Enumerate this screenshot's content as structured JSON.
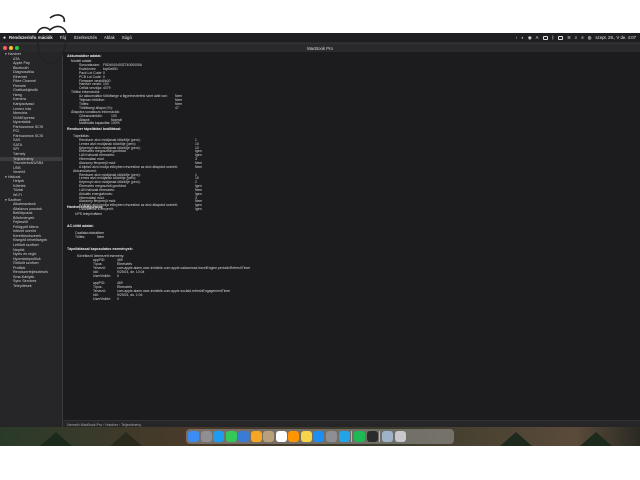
{
  "menubar": {
    "app_name": "Rendszerinformációk",
    "menu_items": [
      "Fájl",
      "Szerkesztés",
      "Ablak",
      "Súgó"
    ],
    "clock": "szept. 29., V de. 4:07"
  },
  "window": {
    "title": "MacBook Pro",
    "path_bar": "Nemeth MacBook Pro › Hardver › Teljesítmény"
  },
  "sidebar": {
    "items": [
      {
        "label": "Hardver",
        "group": true
      },
      {
        "label": "ATA"
      },
      {
        "label": "Apple Pay"
      },
      {
        "label": "Bluetooth"
      },
      {
        "label": "Diagnosztika"
      },
      {
        "label": "Ethernet"
      },
      {
        "label": "Fibre Channel"
      },
      {
        "label": "Firewire"
      },
      {
        "label": "Grafika/kijelzők"
      },
      {
        "label": "Hang"
      },
      {
        "label": "Kamera"
      },
      {
        "label": "Kártyaolvasó"
      },
      {
        "label": "Lemez írás"
      },
      {
        "label": "Memória"
      },
      {
        "label": "NVMExpress"
      },
      {
        "label": "Nyomtatók"
      },
      {
        "label": "Párhuzamos SCSI"
      },
      {
        "label": "PCI"
      },
      {
        "label": "Párhuzamos SCSI"
      },
      {
        "label": "SAS"
      },
      {
        "label": "SATA"
      },
      {
        "label": "SPI"
      },
      {
        "label": "Tárhely"
      },
      {
        "label": "Teljesítmény",
        "selected": true
      },
      {
        "label": "Thunderbolt/USB4"
      },
      {
        "label": "USB"
      },
      {
        "label": "Vezérlő"
      },
      {
        "label": "Hálózat",
        "group": true
      },
      {
        "label": "Helyek"
      },
      {
        "label": "Kötetek"
      },
      {
        "label": "Tűzfal"
      },
      {
        "label": "Wi-Fi"
      },
      {
        "label": "Szoftver",
        "group": true
      },
      {
        "label": "Alkalmazások"
      },
      {
        "label": "Általános posztok"
      },
      {
        "label": "Betűtípusok"
      },
      {
        "label": "Bővítmények"
      },
      {
        "label": "Fejlesztő"
      },
      {
        "label": "Felügyelt kliens"
      },
      {
        "label": "Intézet szerint"
      },
      {
        "label": "Kerettrendszerek"
      },
      {
        "label": "Kisegítő lehetőségek"
      },
      {
        "label": "Letiltott szoftver"
      },
      {
        "label": "Naplók"
      },
      {
        "label": "Nyelv és régió"
      },
      {
        "label": "Nyomtatóprofilok"
      },
      {
        "label": "Örökölt szoftver"
      },
      {
        "label": "Profilok"
      },
      {
        "label": "Rendszerfejlesztések"
      },
      {
        "label": "Sma-Kártyák"
      },
      {
        "label": "Sync Services"
      },
      {
        "label": "Telepítések"
      }
    ]
  },
  "content": {
    "sections": [
      {
        "heading": "Akkumulátor adatai:",
        "rows": [
          {
            "label": "Modell adatai:",
            "value": ""
          },
          {
            "label": "Sorozatszám:",
            "value": "F5D4040400Z74000000A"
          },
          {
            "label": "Eszköznév:",
            "value": "bq40z651"
          },
          {
            "label": "Pack Lot Code:",
            "value": "0"
          },
          {
            "label": "PCB Lot Code:",
            "value": "0"
          },
          {
            "label": "Firmware verzió:",
            "value": "0b00"
          },
          {
            "label": "Hardver verzió:",
            "value": "100"
          },
          {
            "label": "Cellák verziója:",
            "value": "4079"
          },
          {
            "label": "Töltési információk:",
            "value": ""
          },
          {
            "label": "Az akkumulátor töltöttsége a figyelmeztetési szint alatt van:",
            "value": "Nem"
          },
          {
            "label": "Teljesen feltöltve:",
            "value": "Nem"
          },
          {
            "label": "Töltés:",
            "value": "Nem"
          },
          {
            "label": "Töltöttségi állapot (%):",
            "value": "47"
          },
          {
            "label": "Állapotra vonatkozó információk:",
            "value": ""
          },
          {
            "label": "Ciklusszámláló:",
            "value": "103"
          },
          {
            "label": "Állapot:",
            "value": "Normál"
          },
          {
            "label": "Maximális kapacitás:",
            "value": "100%"
          }
        ]
      },
      {
        "heading": "Rendszer tápellátási beállításai:",
        "rows": [
          {
            "label": "Tápellátás:",
            "value": ""
          },
          {
            "label": "Rendszer alvó módjának időzítője (perc):",
            "value": "1"
          },
          {
            "label": "Lemez alvó módjának időzítője (perc):",
            "value": "10"
          },
          {
            "label": "Képernyő alvó módjának időzítője (perc):",
            "value": "10"
          },
          {
            "label": "Ébresztés megosztott gombbal:",
            "value": "Igen"
          },
          {
            "label": "LAN hálózati ébresztés:",
            "value": "Igen"
          },
          {
            "label": "Hibernálási mód:",
            "value": "3"
          },
          {
            "label": "Alacsony fényerejű mód:",
            "value": "Nem"
          },
          {
            "label": "A kijelző alvó módja előnyben részesítse az alvó állapotot szerinti:",
            "value": "Nem"
          },
          {
            "label": "Akkumulátorról:",
            "value": ""
          },
          {
            "label": "Rendszer alvó módjának időzítője (perc):",
            "value": "1"
          },
          {
            "label": "Lemez alvó módjának időzítője (perc):",
            "value": "10"
          },
          {
            "label": "Képernyő alvó módjának időzítője (perc):",
            "value": "2"
          },
          {
            "label": "Ébresztés megosztott gombbal:",
            "value": "Igen"
          },
          {
            "label": "LAN hálózati ébresztés:",
            "value": "Nem"
          },
          {
            "label": "Aktuális energiaforrás:",
            "value": "Igen"
          },
          {
            "label": "Hibernálási mód:",
            "value": "3"
          },
          {
            "label": "Alacsony fényerejű mód:",
            "value": "Nem"
          },
          {
            "label": "A kijelző alvó módja előnyben részesítse az alvó állapotot szerinti:",
            "value": "Igen"
          },
          {
            "label": "Csökkentse a fényerőt:",
            "value": "Igen"
          }
        ]
      },
      {
        "heading": "Hardverkonfiguráció:",
        "rows": [
          {
            "label": "UPS telepítve:",
            "value": "Nem"
          }
        ]
      },
      {
        "heading": "AC-töltő adatai:",
        "rows": [
          {
            "label": "Csatlakoztatva:",
            "value": "Nem"
          },
          {
            "label": "Töltés:",
            "value": "Nem"
          }
        ]
      },
      {
        "heading": "Tápellátással kapcsolatos események:",
        "rows": [
          {
            "label": "Következő ütemezett esemény:",
            "value": ""
          },
          {
            "label": "appPID:",
            "value": "469"
          },
          {
            "label": "Típus:",
            "value": "Ébresztés"
          },
          {
            "label": "Tervező:",
            "value": "com.apple.alarm.user-invisible-com.apple.calaccessd.travelEngine.periodicRefreshTimer"
          },
          {
            "label": "Idő:",
            "value": "9/29/24, de. 10:04"
          },
          {
            "label": "UserVisible:",
            "value": "0"
          },
          {
            "label": "appPID:",
            "value": "469"
          },
          {
            "label": "Típus:",
            "value": "Ébresztés"
          },
          {
            "label": "Tervező:",
            "value": "com.apple.alarm.user-invisible-com.apple.sociald.refreshEngagementTimer"
          },
          {
            "label": "Idő:",
            "value": "9/29/24, du. 1:04"
          },
          {
            "label": "UserVisible:",
            "value": "0"
          }
        ]
      }
    ]
  },
  "dock": {
    "icons": [
      "finder-icon",
      "launchpad-icon",
      "safari-icon",
      "messages-icon",
      "mail-icon",
      "photos-icon",
      "contacts-icon",
      "calendar-icon",
      "reminders-icon",
      "notes-icon",
      "appstore-icon",
      "settings-icon",
      "vscode-icon",
      "spotify-icon",
      "terminal-icon",
      "downloads-icon",
      "trash-icon"
    ]
  }
}
